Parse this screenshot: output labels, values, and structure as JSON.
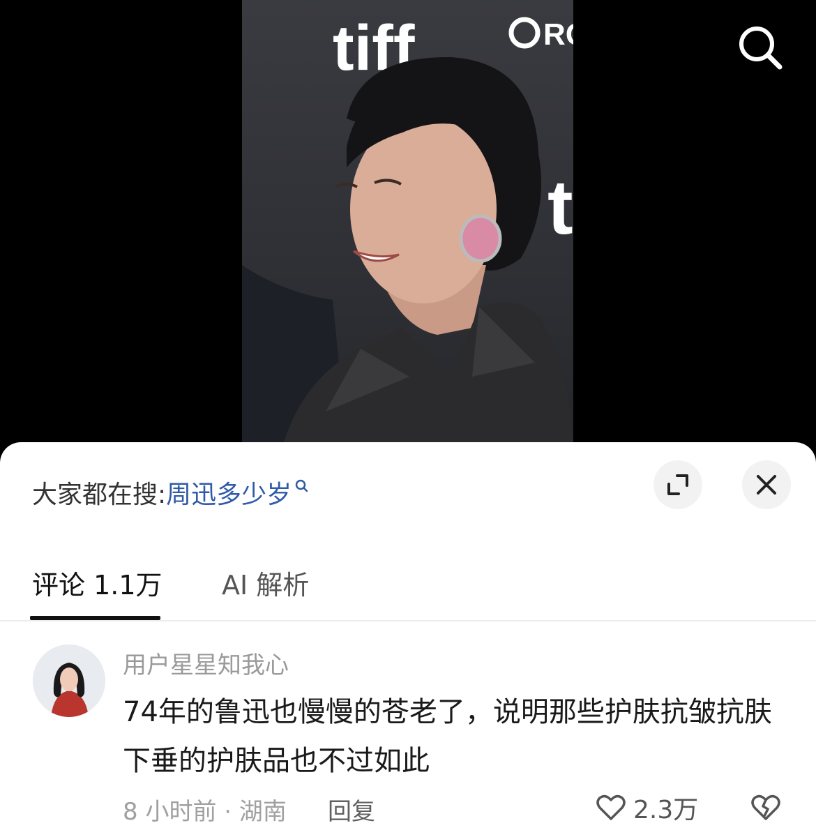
{
  "photo": {
    "backdrop_logo_text": "tiff",
    "backdrop_sponsor_text": "RO",
    "backdrop_side_text": "t"
  },
  "search_prompt": {
    "label": "大家都在搜:",
    "query": "周迅多少岁"
  },
  "tabs": [
    {
      "label": "评论 1.1万",
      "active": true
    },
    {
      "label": "AI 解析",
      "active": false
    }
  ],
  "comment": {
    "username": "用户星星知我心",
    "text": "74年的鲁迅也慢慢的苍老了，说明那些护肤抗皱抗肤下垂的护肤品也不过如此",
    "time_location": "8 小时前 · 湖南",
    "reply_label": "回复",
    "likes": "2.3万"
  },
  "colors": {
    "link_blue": "#2f5aa8",
    "sheet_bg": "#ffffff",
    "stage_bg": "#000000"
  },
  "icons": [
    "search-icon",
    "expand-icon",
    "close-icon",
    "heart-icon",
    "broken-heart-icon"
  ]
}
